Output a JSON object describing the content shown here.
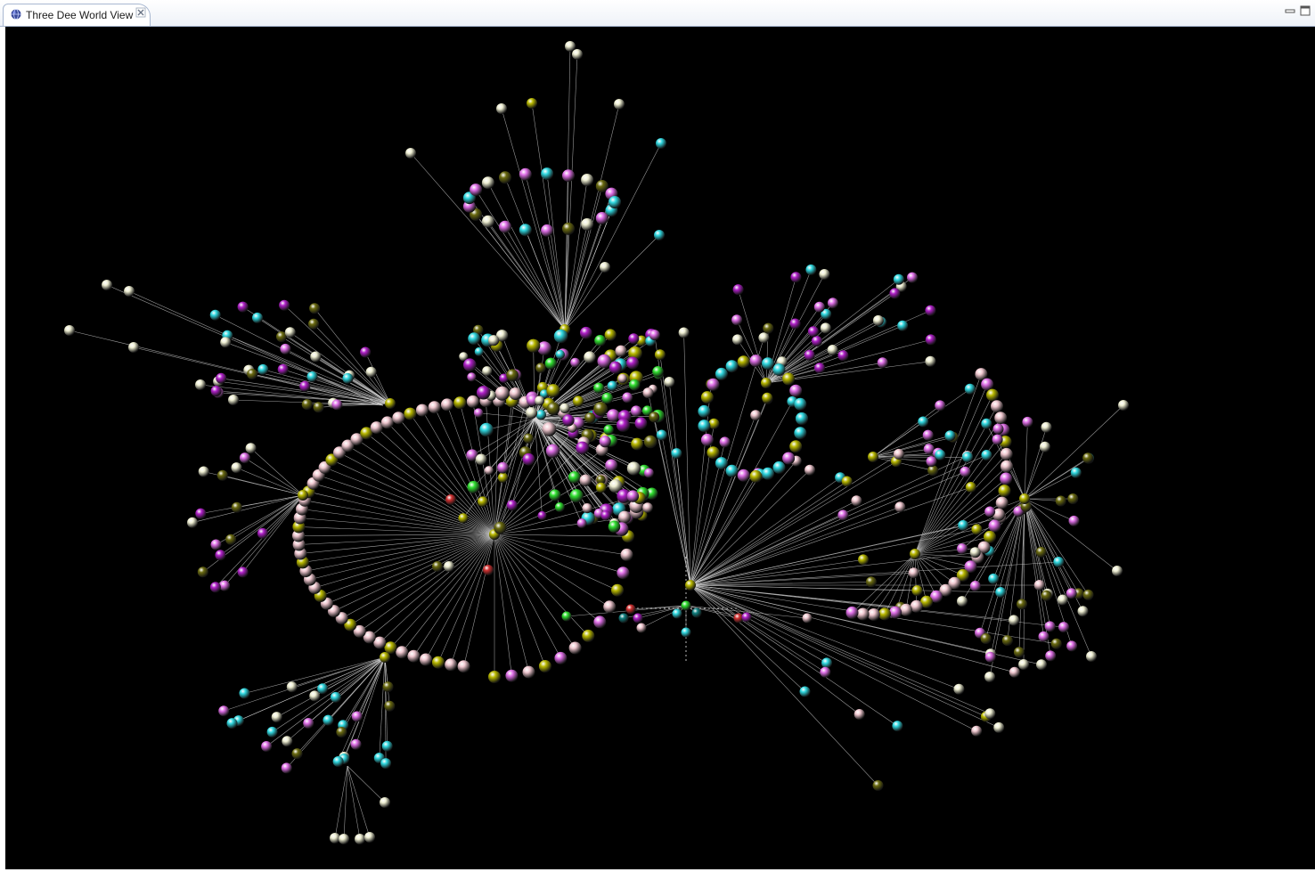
{
  "editor": {
    "tab_title": "Three Dee World View",
    "tab_icon": "globe-icon",
    "close_icon": "close-icon",
    "minimize_icon": "minimize-icon",
    "maximize_icon": "maximize-icon"
  },
  "scene": {
    "background": "#000000",
    "edge_color": "#d8d8d8",
    "node_palette": {
      "pink": "#e070e8",
      "cyan": "#30d8e0",
      "cream": "#eeeed2",
      "olive": "#b8b800",
      "dark_olive": "#6a6a10",
      "blush": "#f0c8d0",
      "purple": "#b020c8",
      "green": "#30e030",
      "red": "#d03030",
      "teal": "#108080"
    }
  }
}
